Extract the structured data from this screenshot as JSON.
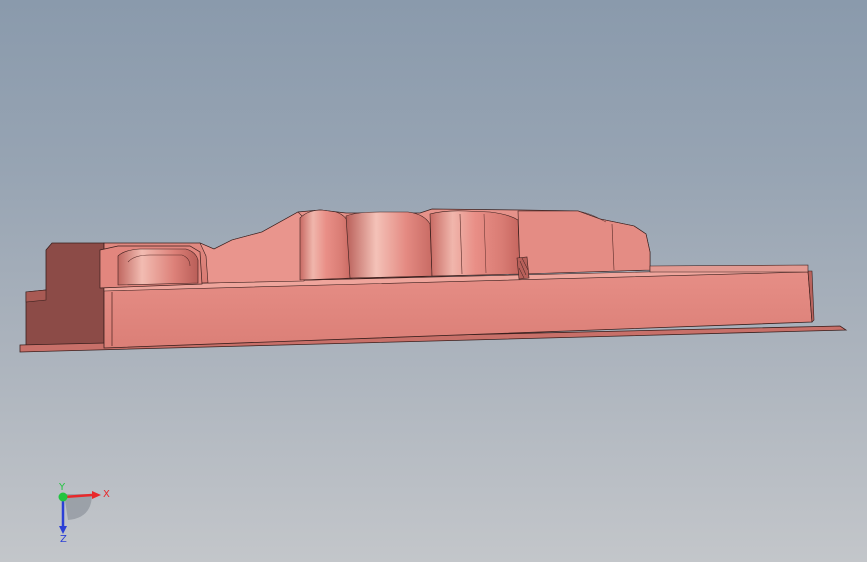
{
  "viewport": {
    "background_top": "#8a9aac",
    "background_bottom": "#c3c6ca",
    "part_color": "#e3877f"
  },
  "triad": {
    "x_label": "X",
    "y_label": "Y",
    "z_label": "Z",
    "x_color": "#e8282a",
    "y_color": "#22c440",
    "z_color": "#2b3fd6"
  }
}
